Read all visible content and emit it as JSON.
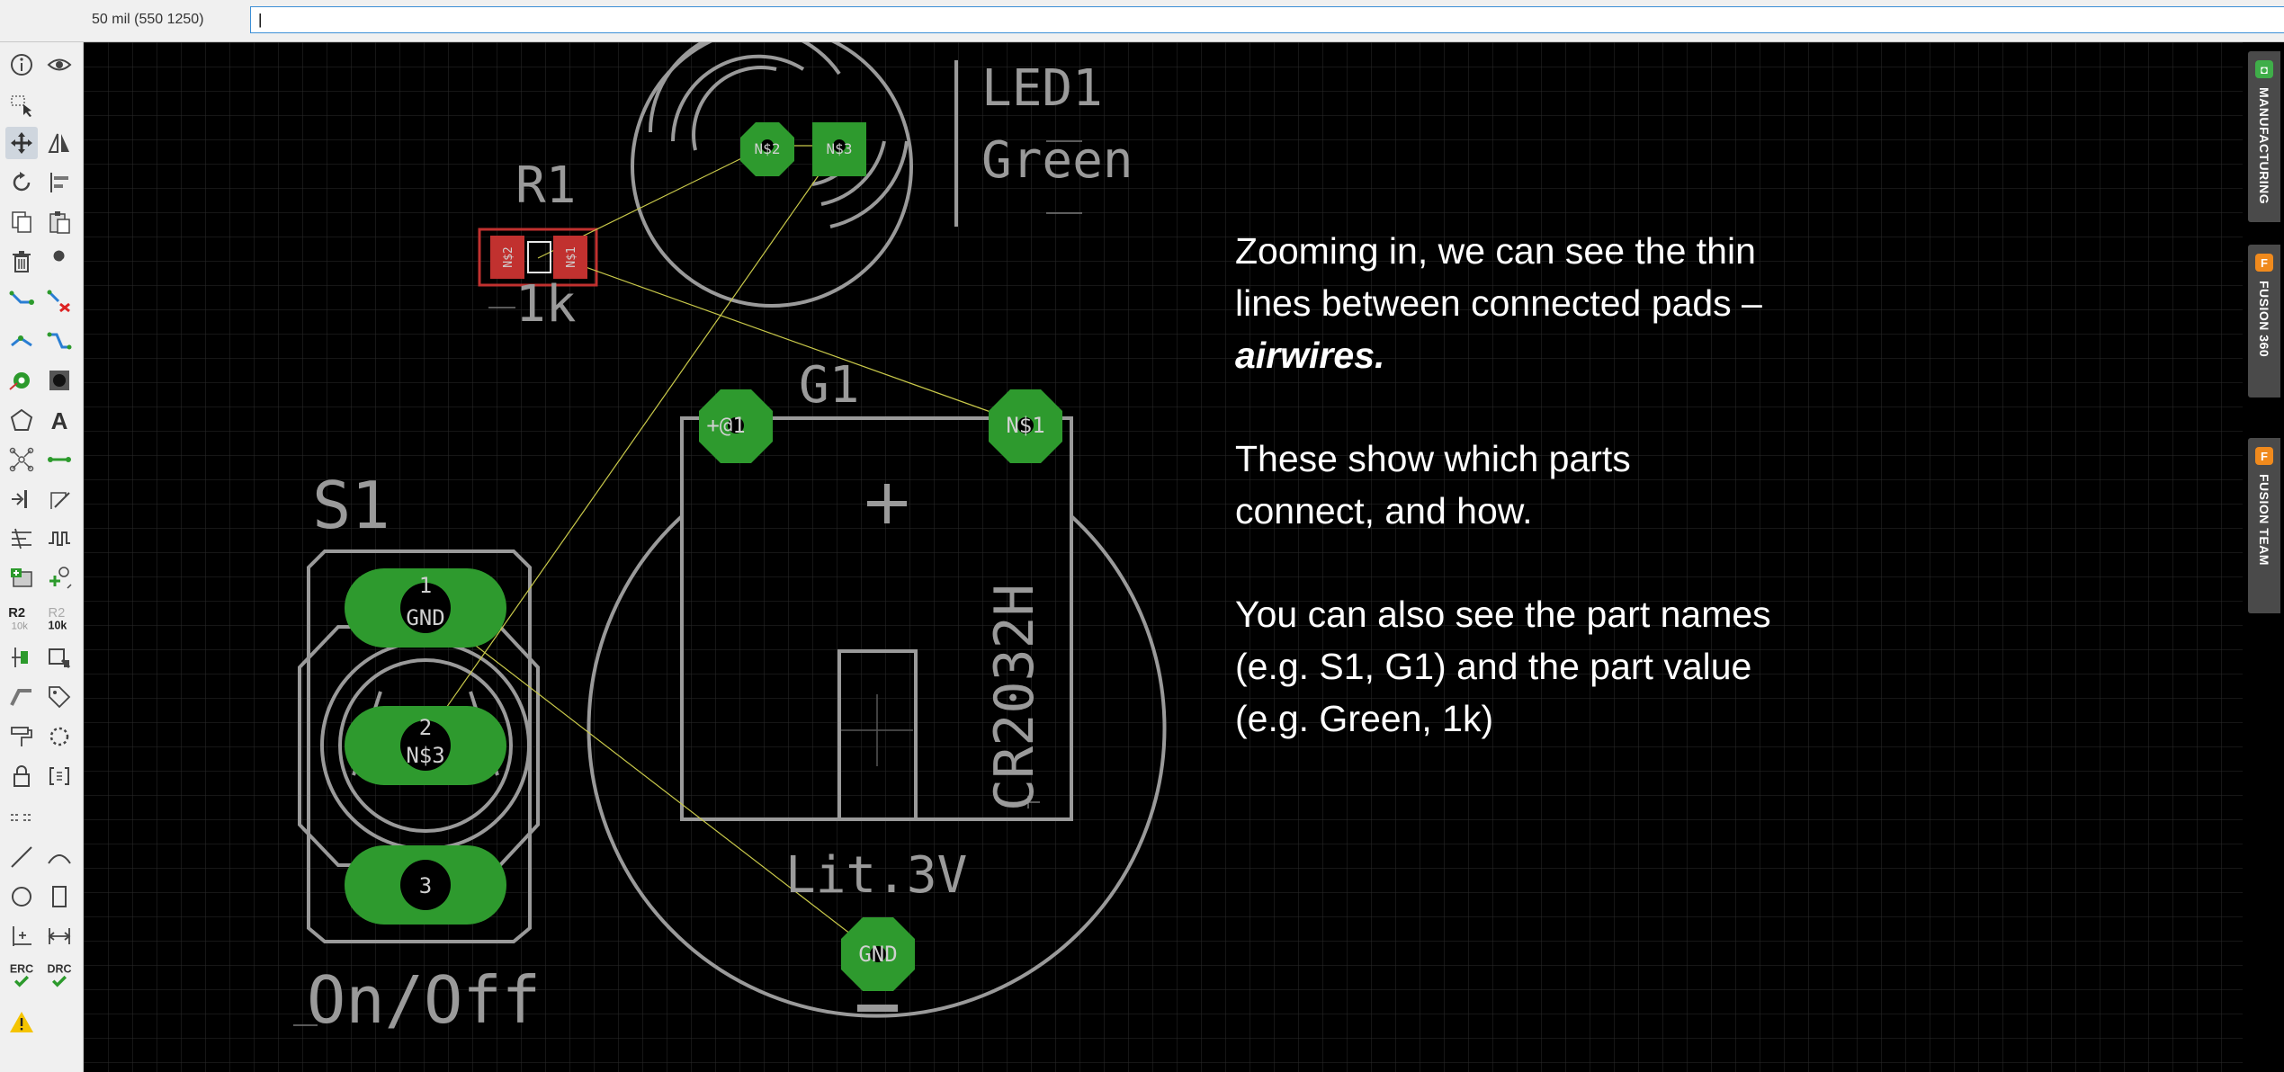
{
  "header": {
    "coordinate_readout": "50 mil (550 1250)",
    "command_value": "|",
    "command_placeholder": ""
  },
  "toolbar": {
    "tools": [
      "info",
      "show",
      "group-select",
      "move",
      "mirror",
      "rotate",
      "align",
      "copy",
      "paste",
      "delete",
      "properties",
      "route",
      "ripup",
      "split",
      "optimize",
      "via",
      "hole",
      "polygon",
      "text",
      "fanout",
      "airwire-route",
      "swap",
      "outline",
      "spread",
      "meander",
      "add-part",
      "replace-part",
      "name",
      "value",
      "smash",
      "change",
      "lock",
      "attribute",
      "pin-swap",
      "miter",
      "line",
      "arc",
      "circle",
      "rectangle",
      "dimension",
      "measure",
      "erc",
      "drc",
      "warnings"
    ],
    "labels": {
      "name_tool": "R2",
      "name_tool_sub": "10k",
      "value_tool": "R2",
      "value_tool_sub": "10k",
      "erc": "ERC",
      "drc": "DRC",
      "text_tool": "A"
    }
  },
  "board": {
    "parts": [
      {
        "name": "LED1",
        "value": "Green",
        "pads": [
          "N$2",
          "N$3"
        ]
      },
      {
        "name": "R1",
        "value": "1k",
        "pads": [
          "N$2",
          "N$1"
        ]
      },
      {
        "name": "G1",
        "value": "Lit.3V",
        "package": "CR2032H",
        "pads": [
          "+@1",
          "N$1",
          "GND"
        ],
        "polarity_plus": "+",
        "polarity_minus": "−"
      },
      {
        "name": "S1",
        "value": "On/Off",
        "pads": [
          "GND",
          "N$3",
          ""
        ],
        "pad_numbers": [
          "1",
          "2",
          "3"
        ]
      }
    ],
    "colors": {
      "background": "#000000",
      "grid": "#2b2b2b",
      "silkscreen": "#9a9a9a",
      "pad": "#2e9a2e",
      "pad_text": "#d0d0d0",
      "smd": "#c1312f",
      "airwire": "#c9c94a"
    }
  },
  "annotation": {
    "p1_text": "Zooming in, we can see the thin lines between connected pads – ",
    "p1_emphasis": "airwires.",
    "p2": "These show which parts connect, and how.",
    "p3": "You can also see the part names (e.g. S1, G1) and the part value (e.g. Green, 1k)"
  },
  "side_panel": {
    "tabs": [
      {
        "label": "MANUFACTURING",
        "icon": "manufacturing-icon",
        "color": "#3fae49"
      },
      {
        "label": "FUSION 360",
        "icon": "fusion-360-icon",
        "color": "#f08a1d"
      },
      {
        "label": "FUSION TEAM",
        "icon": "fusion-team-icon",
        "color": "#f08a1d"
      }
    ]
  }
}
